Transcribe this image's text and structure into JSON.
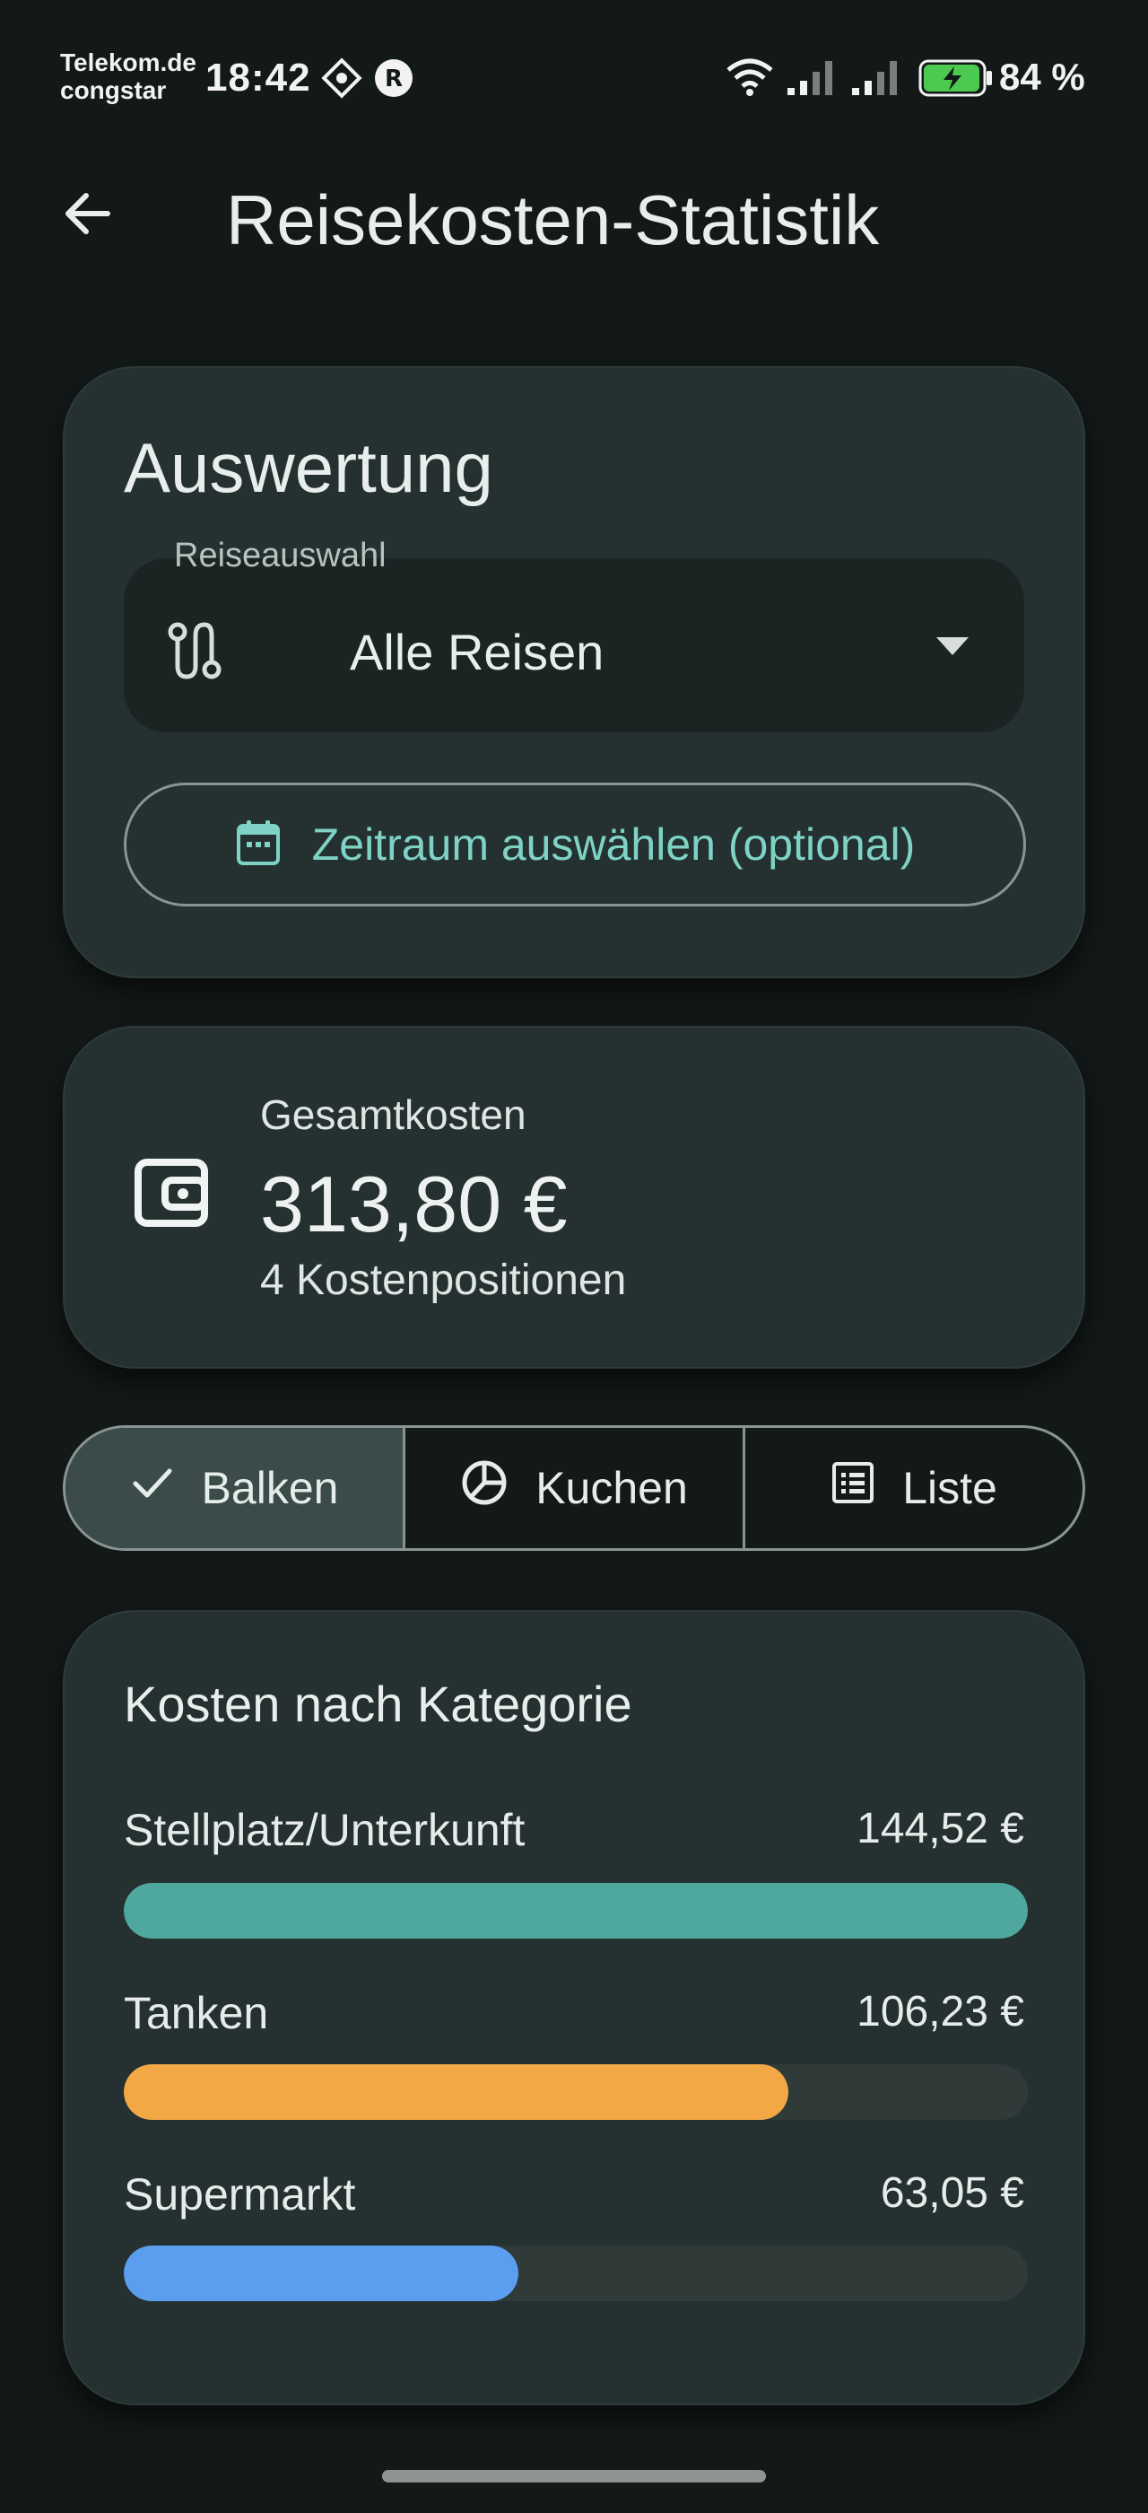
{
  "status_bar": {
    "carrier_line1": "Telekom.de",
    "carrier_line2": "congstar",
    "time": "18:42",
    "battery": "84 %",
    "icons": [
      "nfc-icon",
      "r-app-icon",
      "wifi-icon",
      "signal-icon",
      "signal-icon",
      "battery-charging-icon"
    ]
  },
  "app_bar": {
    "title": "Reisekosten-Statistik",
    "back_icon": "arrow-back-icon"
  },
  "evaluation": {
    "heading": "Auswertung",
    "trip_select": {
      "label": "Reiseauswahl",
      "value": "Alle Reisen",
      "icon": "route-icon"
    },
    "date_range_button": {
      "label": "Zeitraum auswählen (optional)",
      "icon": "calendar-icon"
    }
  },
  "summary": {
    "label": "Gesamtkosten",
    "total": "313,80 €",
    "count_text": "4 Kostenpositionen",
    "icon": "wallet-icon"
  },
  "view_toggle": {
    "options": [
      {
        "label": "Balken",
        "icon": "check-icon",
        "selected": true
      },
      {
        "label": "Kuchen",
        "icon": "pie-chart-icon",
        "selected": false
      },
      {
        "label": "Liste",
        "icon": "list-icon",
        "selected": false
      }
    ]
  },
  "chart_data": {
    "type": "bar",
    "title": "Kosten nach Kategorie",
    "categories": [
      "Stellplatz/Unterkunft",
      "Tanken",
      "Supermarkt"
    ],
    "values": [
      144.52,
      106.23,
      63.05
    ],
    "value_labels": [
      "144,52 €",
      "106,23 €",
      "63,05 €"
    ],
    "colors": [
      "#4ea89e",
      "#f2a945",
      "#5b9ef0"
    ],
    "max": 144.52
  }
}
